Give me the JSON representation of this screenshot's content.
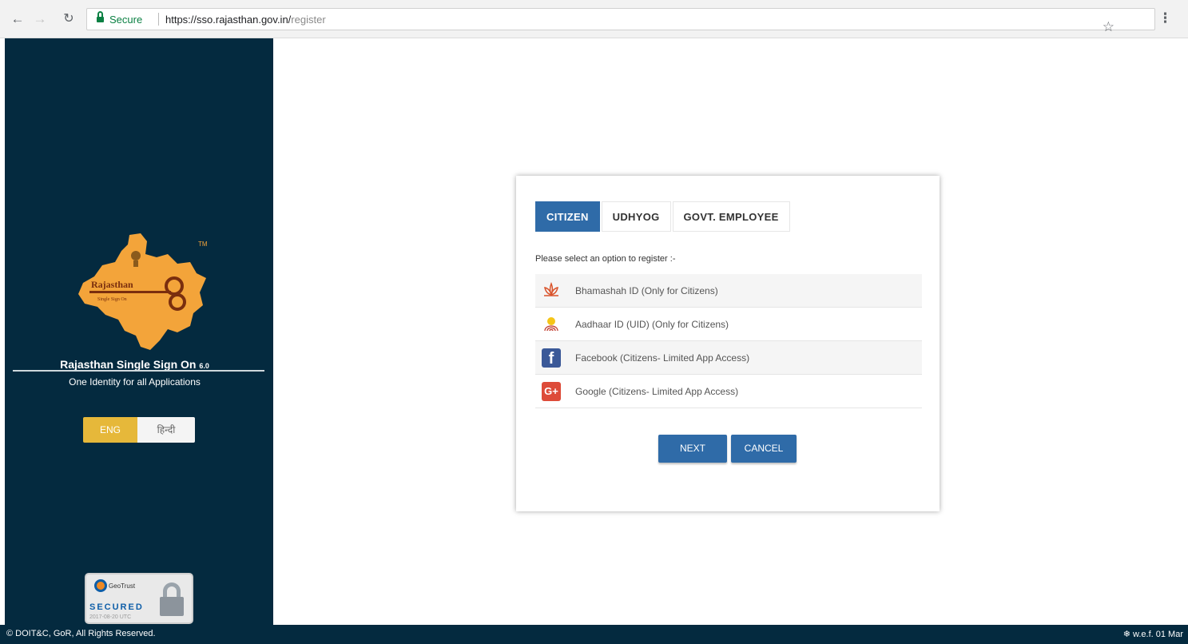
{
  "browser": {
    "secure_label": "Secure",
    "url_host": "https://sso.rajasthan.gov.in/",
    "url_path": "register",
    "icons": [
      "back-icon",
      "forward-icon",
      "reload-icon",
      "lock-icon",
      "star-icon",
      "menu-icon"
    ]
  },
  "sidebar": {
    "logo_text": "Rajasthan",
    "logo_subtext": "Single Sign On",
    "title": "Rajasthan Single Sign On",
    "version": "6.0",
    "subtitle": "One Identity for all Applications",
    "lang_eng": "ENG",
    "lang_hindi": "हिन्दी",
    "seal_brand": "GeoTrust",
    "seal_secured": "SECURED",
    "seal_date": "2017-08-20 UTC"
  },
  "card": {
    "tabs": [
      "CITIZEN",
      "UDHYOG",
      "GOVT. EMPLOYEE"
    ],
    "active_tab": "CITIZEN",
    "prompt": "Please select an option to register :-",
    "options": [
      {
        "label": "Bhamashah ID (Only for Citizens)",
        "icon": "bhamashah-icon"
      },
      {
        "label": "Aadhaar ID (UID) (Only for Citizens)",
        "icon": "aadhaar-icon"
      },
      {
        "label": "Facebook (Citizens- Limited App Access)",
        "icon": "facebook-icon"
      },
      {
        "label": "Google (Citizens- Limited App Access)",
        "icon": "google-icon"
      }
    ],
    "next_label": "NEXT",
    "cancel_label": "CANCEL"
  },
  "footer": {
    "copyright": "© DOIT&C, GoR, All Rights Reserved.",
    "right_text": "❄ w.e.f. 01 Mar"
  },
  "colors": {
    "sidebar_bg": "#042a3f",
    "primary": "#2f6ba8",
    "lang_active": "#e6b83a",
    "logo": "#f3a43a"
  }
}
